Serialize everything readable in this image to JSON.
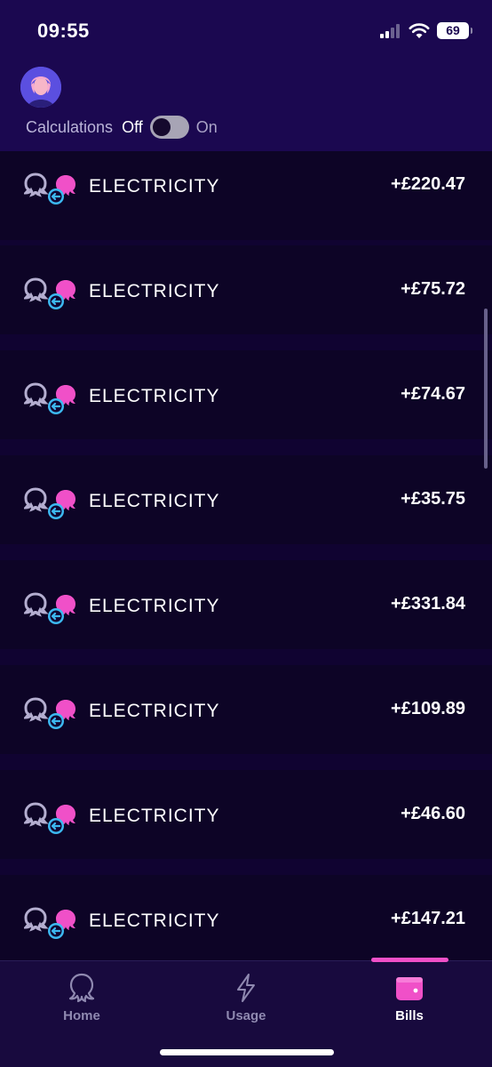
{
  "status_bar": {
    "time": "09:55",
    "battery": "69"
  },
  "header": {
    "calculations_label": "Calculations",
    "toggle_off_label": "Off",
    "toggle_on_label": "On",
    "toggle_state": "off"
  },
  "transactions": [
    {
      "label": "ELECTRICITY",
      "amount": "+£220.47"
    },
    {
      "label": "ELECTRICITY",
      "amount": "+£75.72"
    },
    {
      "label": "ELECTRICITY",
      "amount": "+£74.67"
    },
    {
      "label": "ELECTRICITY",
      "amount": "+£35.75"
    },
    {
      "label": "ELECTRICITY",
      "amount": "+£331.84"
    },
    {
      "label": "ELECTRICITY",
      "amount": "+£109.89"
    },
    {
      "label": "ELECTRICITY",
      "amount": "+£46.60"
    },
    {
      "label": "ELECTRICITY",
      "amount": "+£147.21"
    }
  ],
  "tabbar": {
    "items": [
      {
        "label": "Home",
        "icon": "octopus-icon"
      },
      {
        "label": "Usage",
        "icon": "lightning-icon"
      },
      {
        "label": "Bills",
        "icon": "wallet-icon"
      }
    ],
    "active": "Bills"
  },
  "colors": {
    "background": "#100331",
    "header": "#1b0850",
    "accent_pink": "#f050c8",
    "accent_blue": "#3cb8f0",
    "outline_gray": "#b4aed0"
  }
}
